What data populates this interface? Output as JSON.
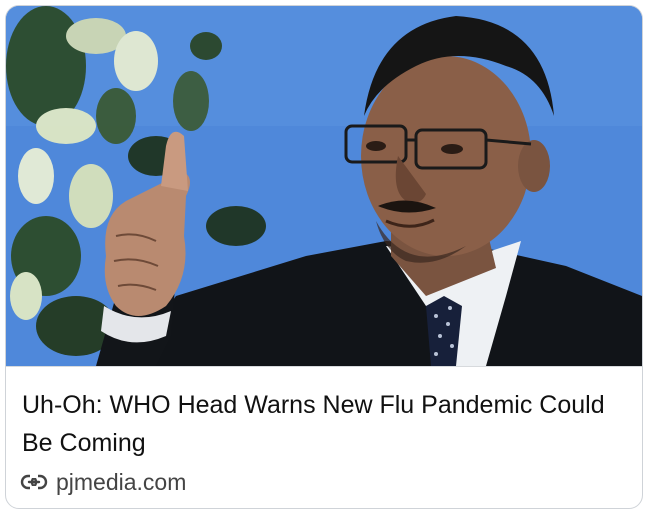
{
  "card": {
    "headline": "Uh-Oh: WHO Head Warns New Flu Pandemic Could Be Coming",
    "source_domain": "pjmedia.com",
    "source_icon": "link-icon",
    "thumbnail": {
      "kind": "photo",
      "subject": "man in suit with glasses pointing finger, blue background with leaves"
    }
  },
  "colors": {
    "background": "#ffffff",
    "card_border": "#cfd3d8",
    "headline_text": "#111111",
    "domain_text": "#444444",
    "photo_background": "#4d86d9"
  }
}
